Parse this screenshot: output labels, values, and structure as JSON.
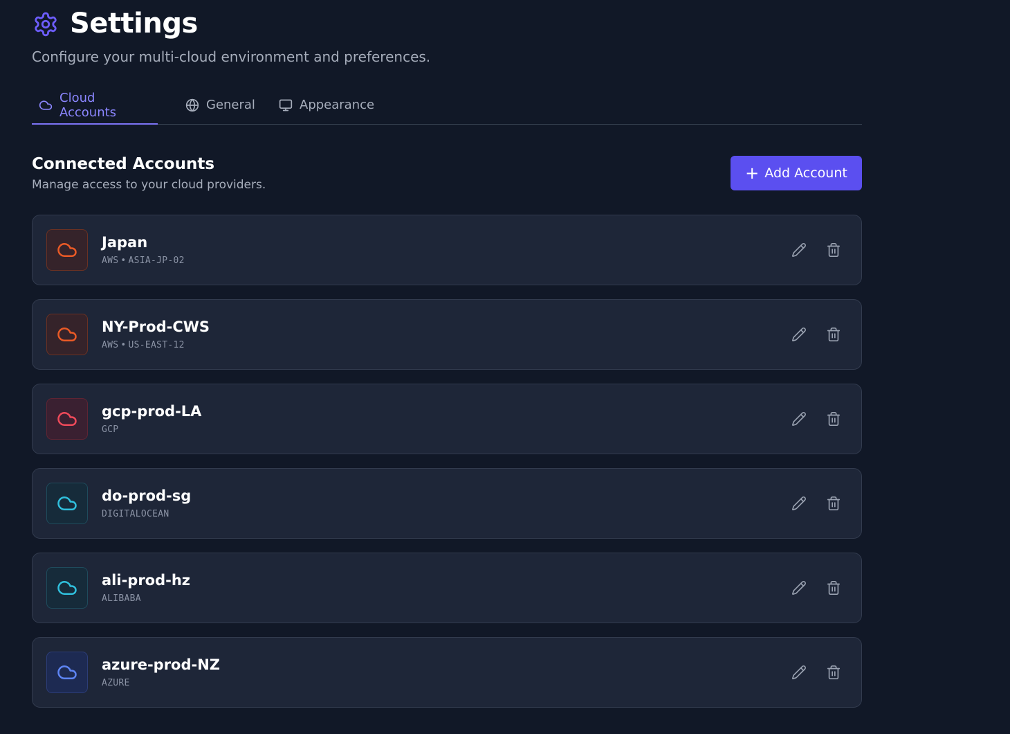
{
  "header": {
    "title": "Settings",
    "icon": "gear-icon",
    "subtitle": "Configure your multi-cloud environment and preferences."
  },
  "tabs": [
    {
      "label": "Cloud Accounts",
      "icon": "cloud-icon",
      "active": true
    },
    {
      "label": "General",
      "icon": "globe-icon",
      "active": false
    },
    {
      "label": "Appearance",
      "icon": "monitor-icon",
      "active": false
    }
  ],
  "section": {
    "title": "Connected Accounts",
    "subtitle": "Manage access to your cloud providers.",
    "add_button": "Add Account"
  },
  "colors": {
    "accent": "#5b4ff0",
    "aws": "#ea5a26",
    "gcp": "#ef4a5a",
    "digitalocean": "#30c0dd",
    "alibaba": "#30c0dd",
    "azure": "#5e85f5"
  },
  "accounts": [
    {
      "name": "Japan",
      "provider": "AWS",
      "region": "ASIA-JP-02",
      "tone": "orange"
    },
    {
      "name": "NY-Prod-CWS",
      "provider": "AWS",
      "region": "US-EAST-12",
      "tone": "orange"
    },
    {
      "name": "gcp-prod-LA",
      "provider": "GCP",
      "region": "",
      "tone": "red"
    },
    {
      "name": "do-prod-sg",
      "provider": "DIGITALOCEAN",
      "region": "",
      "tone": "cyan"
    },
    {
      "name": "ali-prod-hz",
      "provider": "ALIBABA",
      "region": "",
      "tone": "cyan"
    },
    {
      "name": "azure-prod-NZ",
      "provider": "AZURE",
      "region": "",
      "tone": "blue"
    }
  ]
}
